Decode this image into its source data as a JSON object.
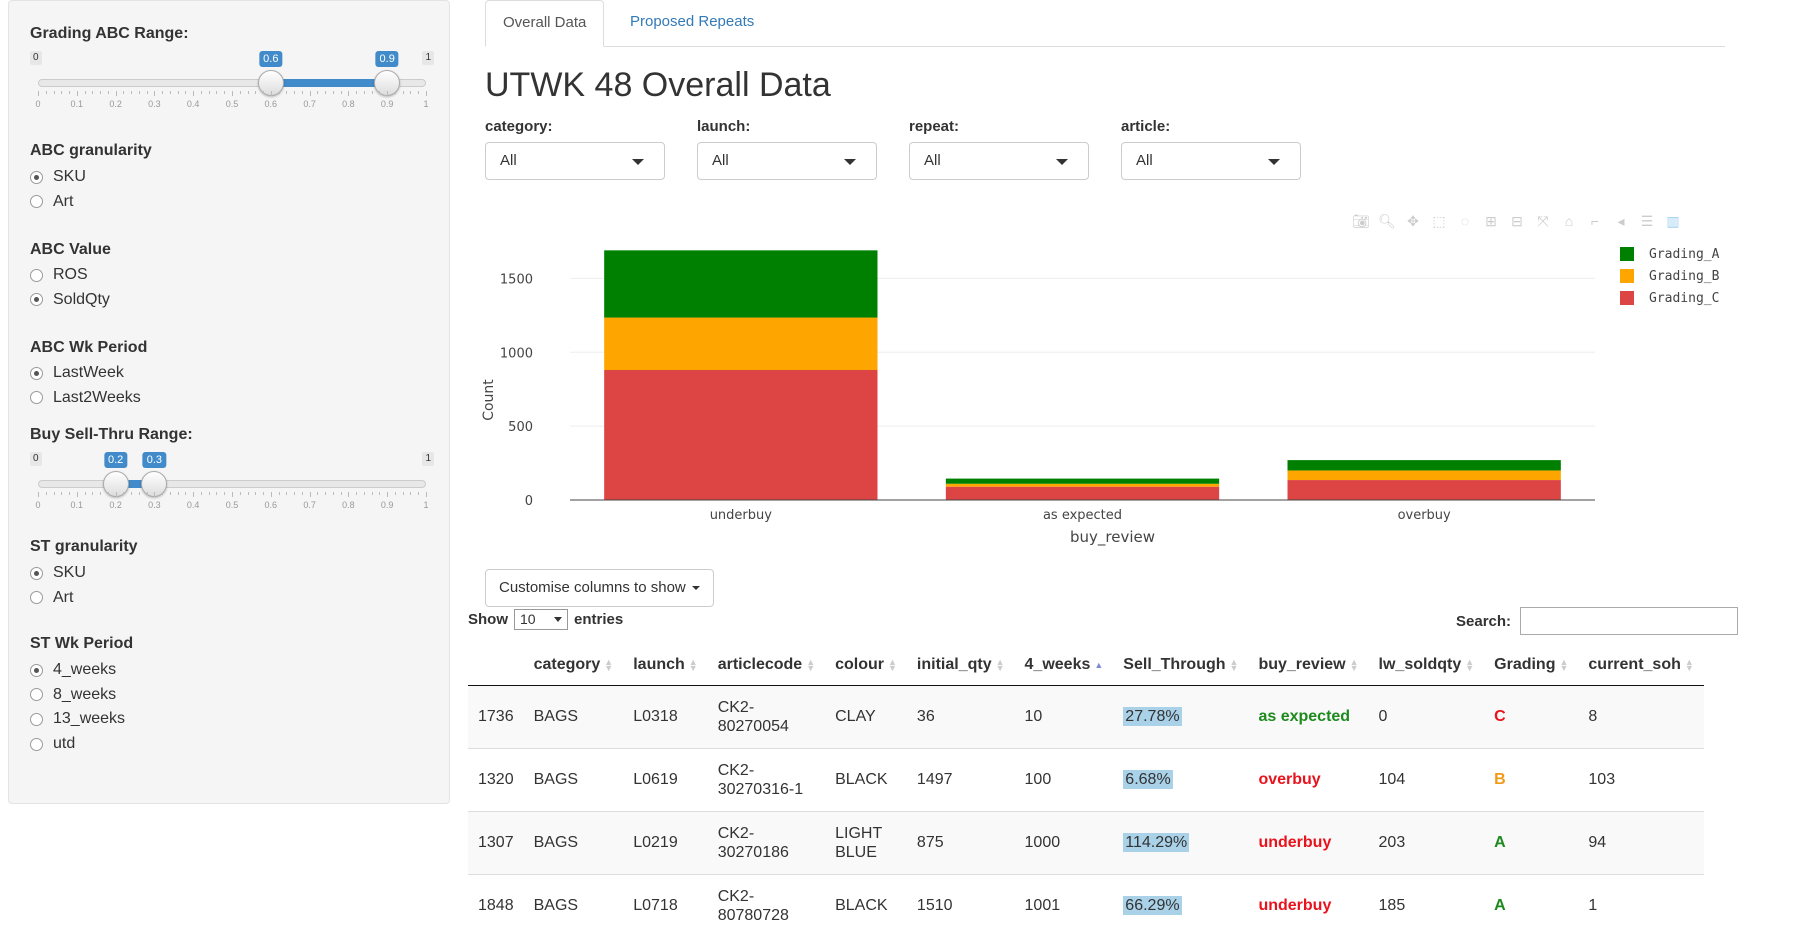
{
  "sidebar": {
    "grading_range": {
      "label": "Grading ABC Range:",
      "min": "0",
      "max": "1",
      "low": "0.6",
      "high": "0.9",
      "low_value": 0.6,
      "high_value": 0.9,
      "ticks": [
        "0",
        "0.1",
        "0.2",
        "0.3",
        "0.4",
        "0.5",
        "0.6",
        "0.7",
        "0.8",
        "0.9",
        "1"
      ]
    },
    "abc_granularity": {
      "label": "ABC granularity",
      "options": [
        "SKU",
        "Art"
      ],
      "selected": 0
    },
    "abc_value": {
      "label": "ABC Value",
      "options": [
        "ROS",
        "SoldQty"
      ],
      "selected": 1
    },
    "abc_wk_period": {
      "label": "ABC Wk Period",
      "options": [
        "LastWeek",
        "Last2Weeks"
      ],
      "selected": 0
    },
    "buy_range": {
      "label": "Buy Sell-Thru Range:",
      "min": "0",
      "max": "1",
      "low": "0.2",
      "high": "0.3",
      "low_value": 0.2,
      "high_value": 0.3,
      "ticks": [
        "0",
        "0.1",
        "0.2",
        "0.3",
        "0.4",
        "0.5",
        "0.6",
        "0.7",
        "0.8",
        "0.9",
        "1"
      ]
    },
    "st_granularity": {
      "label": "ST granularity",
      "options": [
        "SKU",
        "Art"
      ],
      "selected": 0
    },
    "st_wk_period": {
      "label": "ST Wk Period",
      "options": [
        "4_weeks",
        "8_weeks",
        "13_weeks",
        "utd"
      ],
      "selected": 0
    }
  },
  "tabs": [
    "Overall Data",
    "Proposed Repeats"
  ],
  "title": "UTWK 48 Overall Data",
  "filters": [
    {
      "label": "category:",
      "value": "All"
    },
    {
      "label": "launch:",
      "value": "All"
    },
    {
      "label": "repeat:",
      "value": "All"
    },
    {
      "label": "article:",
      "value": "All"
    }
  ],
  "modebar_icons": [
    "camera-icon",
    "zoom-icon",
    "pan-icon",
    "box-select-icon",
    "lasso-icon",
    "zoom-in-icon",
    "zoom-out-icon",
    "autoscale-icon",
    "reset-axes-icon",
    "spike-lines-icon",
    "hover-closest-icon",
    "hover-compare-icon",
    "plotly-logo-icon"
  ],
  "chart_data": {
    "type": "bar",
    "stacked": true,
    "categories": [
      "underbuy",
      "as expected",
      "overbuy"
    ],
    "series": [
      {
        "name": "Grading_C",
        "color": "#dd4444",
        "values": [
          880,
          90,
          135
        ]
      },
      {
        "name": "Grading_B",
        "color": "#ffa500",
        "values": [
          355,
          20,
          65
        ]
      },
      {
        "name": "Grading_A",
        "color": "#008000",
        "values": [
          455,
          35,
          70
        ]
      }
    ],
    "xlabel": "buy_review",
    "ylabel": "Count",
    "ylim": [
      0,
      1760
    ],
    "yticks": [
      0,
      500,
      1000,
      1500
    ],
    "grid": true,
    "legend_position": "top-right",
    "legend_order": [
      "Grading_A",
      "Grading_B",
      "Grading_C"
    ]
  },
  "customise_button": "Customise columns to show",
  "table": {
    "show_label": "Show",
    "entries_value": "10",
    "entries_label": "entries",
    "search_label": "Search:",
    "columns": [
      "",
      "category",
      "launch",
      "articlecode",
      "colour",
      "initial_qty",
      "4_weeks",
      "Sell_Through",
      "buy_review",
      "lw_soldqty",
      "Grading",
      "current_soh"
    ],
    "rows": [
      [
        "1736",
        "BAGS",
        "L0318",
        "CK2-80270054",
        "CLAY",
        "36",
        "10",
        "27.78%",
        "as expected",
        "0",
        "C",
        "8"
      ],
      [
        "1320",
        "BAGS",
        "L0619",
        "CK2-30270316-1",
        "BLACK",
        "1497",
        "100",
        "6.68%",
        "overbuy",
        "104",
        "B",
        "103"
      ],
      [
        "1307",
        "BAGS",
        "L0219",
        "CK2-30270186",
        "LIGHT BLUE",
        "875",
        "1000",
        "114.29%",
        "underbuy",
        "203",
        "A",
        "94"
      ],
      [
        "1848",
        "BAGS",
        "L0718",
        "CK2-80780728",
        "BLACK",
        "1510",
        "1001",
        "66.29%",
        "underbuy",
        "185",
        "A",
        "1"
      ]
    ]
  }
}
